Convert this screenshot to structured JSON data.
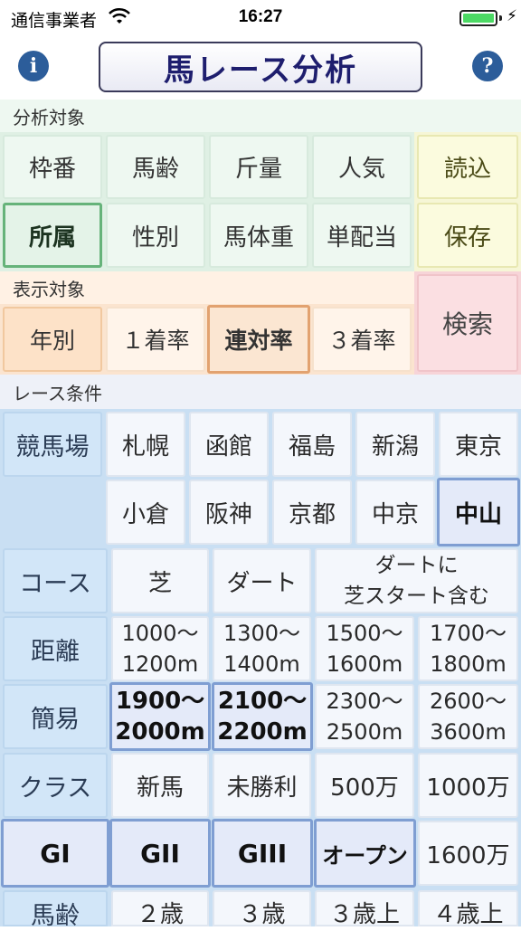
{
  "status_bar": {
    "carrier": "通信事業者",
    "time": "16:27"
  },
  "header": {
    "info_icon": "i",
    "help_icon": "?",
    "title": "馬レース分析"
  },
  "analysis_section": {
    "label": "分析対象",
    "row1": [
      "枠番",
      "馬齢",
      "斤量",
      "人気"
    ],
    "row2": [
      "所属",
      "性別",
      "馬体重",
      "単配当"
    ],
    "load_button": "読込",
    "save_button": "保存",
    "selected": "所属"
  },
  "display_section": {
    "label": "表示対象",
    "items": [
      "年別",
      "１着率",
      "連対率",
      "３着率"
    ],
    "selected": "連対率",
    "search_button": "検索"
  },
  "race_conditions": {
    "label": "レース条件",
    "racecourse": {
      "header": "競馬場",
      "row1": [
        "札幌",
        "函館",
        "福島",
        "新潟",
        "東京"
      ],
      "row2": [
        "小倉",
        "阪神",
        "京都",
        "中京",
        "中山"
      ],
      "selected": "中山"
    },
    "course": {
      "header": "コース",
      "items": [
        "芝",
        "ダート"
      ],
      "dirt_turf_line1": "ダートに",
      "dirt_turf_line2": "芝スタート含む"
    },
    "distance": {
      "header": "距離",
      "items": [
        {
          "a": "1000〜",
          "b": "1200m"
        },
        {
          "a": "1300〜",
          "b": "1400m"
        },
        {
          "a": "1500〜",
          "b": "1600m"
        },
        {
          "a": "1700〜",
          "b": "1800m"
        }
      ]
    },
    "simple": {
      "header": "簡易",
      "items": [
        {
          "a": "1900〜",
          "b": "2000m"
        },
        {
          "a": "2100〜",
          "b": "2200m"
        },
        {
          "a": "2300〜",
          "b": "2500m"
        },
        {
          "a": "2600〜",
          "b": "3600m"
        }
      ],
      "selected": [
        "1900〜2000m",
        "2100〜2200m"
      ]
    },
    "class": {
      "header": "クラス",
      "row1": [
        "新馬",
        "未勝利",
        "500万",
        "1000万"
      ],
      "row2": [
        "GI",
        "GII",
        "GIII",
        "オープン",
        "1600万"
      ],
      "selected": [
        "GI",
        "GII",
        "GIII",
        "オープン"
      ]
    },
    "age": {
      "header": "馬齢",
      "items": [
        "２歳",
        "３歳",
        "３歳上",
        "４歳上"
      ]
    }
  },
  "colors": {
    "title_text": "#1e1e6e",
    "icon_blue": "#2c5d9a",
    "battery_green": "#4cd964",
    "green_selected_border": "#66b37a",
    "blue_selected_border": "#7f9ed2"
  }
}
